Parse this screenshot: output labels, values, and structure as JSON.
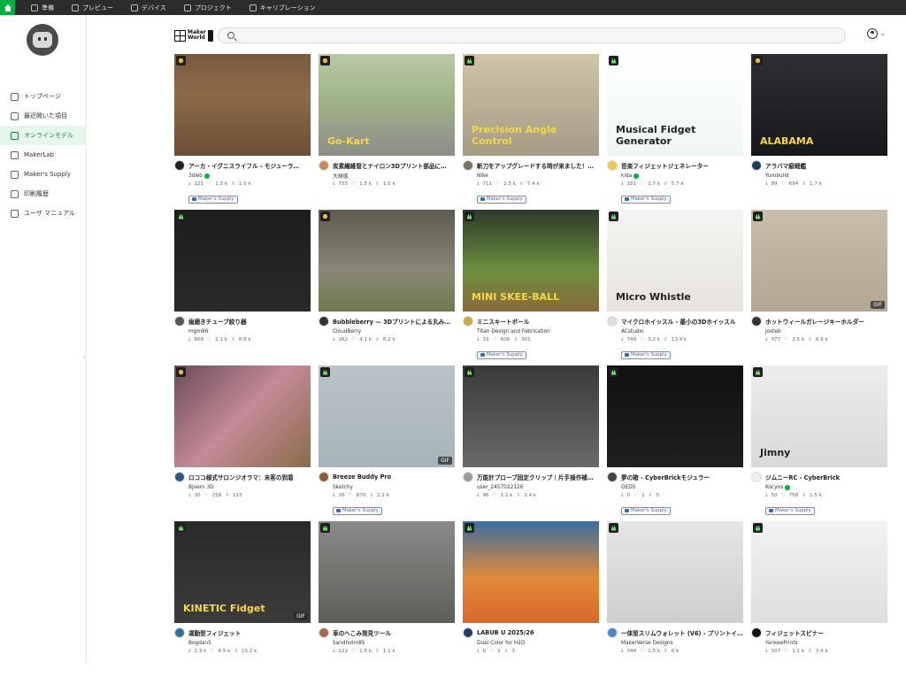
{
  "topbar": {
    "tabs": [
      {
        "label": "準備",
        "icon": "home-icon"
      },
      {
        "label": "プレビュー",
        "icon": "layers-icon"
      },
      {
        "label": "デバイス",
        "icon": "device-icon"
      },
      {
        "label": "プロジェクト",
        "icon": "project-icon"
      },
      {
        "label": "キャリブレーション",
        "icon": "calibration-icon"
      }
    ]
  },
  "sidebar": {
    "items": [
      {
        "label": "トップページ",
        "icon": "home-icon"
      },
      {
        "label": "最近開いた項目",
        "icon": "clock-icon"
      },
      {
        "label": "オンラインモデル",
        "icon": "grid-icon",
        "active": true
      },
      {
        "label": "MakerLab",
        "icon": "lab-icon"
      },
      {
        "label": "Maker's Supply",
        "icon": "supply-icon"
      },
      {
        "label": "印刷履歴",
        "icon": "history-icon"
      },
      {
        "label": "ユーザ マニュアル",
        "icon": "manual-icon"
      }
    ]
  },
  "header": {
    "logo_text_1": "Maker",
    "logo_text_2": "World",
    "search_placeholder": ""
  },
  "supply_label": "Maker's Supply",
  "colors": {
    "accent": "#00ae42",
    "supply": "#3d66b8",
    "topbar": "#2c2c2c"
  },
  "cards": [
    {
      "title": "アーカ・イグニスライフル - モジューラ…",
      "author": "3dwb",
      "verified": true,
      "stats": [
        "121",
        "1.3 k",
        "1.5 k"
      ],
      "supply": true,
      "badge": "gold",
      "gif": false,
      "thumb_text": "",
      "bg": "linear-gradient(180deg,#7a5a3e 0%,#8d6a48 40%,#6b4f35 100%)",
      "avatar": "#222"
    },
    {
      "title": "炭素繊維管とナイロン3Dプリント部品に…",
      "author": "大胡徳",
      "verified": false,
      "stats": [
        "755",
        "1.5 k",
        "1.5 k"
      ],
      "supply": false,
      "badge": "gold",
      "gif": false,
      "thumb_text": "Go-Kart",
      "bg": "linear-gradient(180deg,#b7c9a8 0%,#9fb387 45%,#8d8d88 100%)",
      "avatar": "#c98d5a"
    },
    {
      "title": "斬刀をアップグレードする時が来ました！…",
      "author": "Nike",
      "verified": false,
      "stats": [
        "711",
        "2.5 k",
        "7.4 k"
      ],
      "supply": true,
      "badge": "green",
      "gif": false,
      "thumb_text": "Precision Angle Control",
      "bg": "linear-gradient(180deg,#cfc4a8 0%,#a59c84 100%)",
      "avatar": "#7a6f62"
    },
    {
      "title": "音楽フィジェットジェネレーター",
      "author": "kida",
      "verified": true,
      "stats": [
        "181",
        "1.7 k",
        "5.7 k"
      ],
      "supply": true,
      "badge": "green",
      "gif": false,
      "thumb_text": "Musical Fidget Generator",
      "bg": "linear-gradient(180deg,#ffffff 0%,#eef6f5 100%)",
      "avatar": "#f2c94c"
    },
    {
      "title": "アラバマ級戦艦",
      "author": "Yurobuild",
      "verified": false,
      "stats": [
        "89",
        "694",
        "1.7 k"
      ],
      "supply": false,
      "badge": "gold",
      "gif": false,
      "thumb_text": "ALABAMA",
      "bg": "linear-gradient(180deg,#2d2f33 0%,#16181b 100%)",
      "avatar": "#1c3e57"
    },
    {
      "title": "歯磨きチューブ絞り器",
      "author": "mgm86",
      "verified": false,
      "stats": [
        "668",
        "2.1 k",
        "8.8 k"
      ],
      "supply": false,
      "badge": "green",
      "gif": false,
      "thumb_text": "",
      "bg": "linear-gradient(180deg,#1d1d1d 0%,#2a2a2a 100%)",
      "avatar": "#555"
    },
    {
      "title": "Bubbleberry — 3Dプリントによる丸み…",
      "author": "CloudBerry",
      "verified": false,
      "stats": [
        "262",
        "4.1 k",
        "8.2 k"
      ],
      "supply": false,
      "badge": "gold",
      "gif": false,
      "thumb_text": "",
      "bg": "linear-gradient(180deg,#5e5a4f 0%,#8a8778 60%,#6f7a4c 100%)",
      "avatar": "#333"
    },
    {
      "title": "ミニスキートボール",
      "author": "Titan Design and Fabrication",
      "verified": false,
      "stats": [
        "19",
        "606",
        "301"
      ],
      "supply": true,
      "badge": "green",
      "gif": false,
      "thumb_text": "MINI SKEE-BALL",
      "bg": "linear-gradient(180deg,#2e3a2a 0%,#6d8f3e 60%,#8a6a3c 100%)",
      "avatar": "#c9a64b"
    },
    {
      "title": "マイクロホイッスル - 最小の3Dホイッスル",
      "author": "ACstudio",
      "verified": false,
      "stats": [
        "749",
        "3.2 k",
        "13.4 k"
      ],
      "supply": true,
      "badge": "green",
      "gif": false,
      "thumb_text": "Micro Whistle",
      "bg": "linear-gradient(180deg,#f5f5f3 0%,#e7e3de 100%)",
      "avatar": "#ddd"
    },
    {
      "title": "ホットウィールガレージキーホルダー",
      "author": "josteb",
      "verified": false,
      "stats": [
        "377",
        "2.5 k",
        "6.9 k"
      ],
      "supply": false,
      "badge": "green",
      "gif": true,
      "thumb_text": "",
      "bg": "linear-gradient(180deg,#c9beaa 0%,#b3a692 100%)",
      "avatar": "#333"
    },
    {
      "title": "ロココ様式サロンジオラマ：未客の到着",
      "author": "Bjoern 3D",
      "verified": false,
      "stats": [
        "30",
        "258",
        "115"
      ],
      "supply": false,
      "badge": "gold",
      "gif": false,
      "thumb_text": "",
      "bg": "linear-gradient(135deg,#6d4b5b 0%,#c48a97 50%,#8a6c47 100%)",
      "avatar": "#2e5a7a"
    },
    {
      "title": "Breeze Buddy Pro",
      "author": "Sketchy",
      "verified": false,
      "stats": [
        "26",
        "870",
        "2.2 k"
      ],
      "supply": true,
      "badge": "green",
      "gif": true,
      "thumb_text": "",
      "bg": "linear-gradient(180deg,#b9c3c8 0%,#a7b4bb 100%)",
      "avatar": "#8f5b3a"
    },
    {
      "title": "万能計プローブ固定クリップ｜片手操作補…",
      "author": "user_2457022126",
      "verified": false,
      "stats": [
        "96",
        "1.1 k",
        "2.4 k"
      ],
      "supply": false,
      "badge": "green",
      "gif": false,
      "thumb_text": "",
      "bg": "linear-gradient(180deg,#3a3a3a 0%,#6a6a6a 100%)",
      "avatar": "#999"
    },
    {
      "title": "夢の箱 - CyberBrickモジュラー",
      "author": "OEDS",
      "verified": false,
      "stats": [
        "0",
        "2",
        "0"
      ],
      "supply": true,
      "badge": "green",
      "gif": false,
      "thumb_text": "",
      "bg": "linear-gradient(180deg,#111 0%,#1f1f1f 100%)",
      "avatar": "#444"
    },
    {
      "title": "ジムニーRC - CyberBrick",
      "author": "Kocyns",
      "verified": true,
      "stats": [
        "50",
        "758",
        "1.5 k"
      ],
      "supply": true,
      "badge": "green",
      "gif": false,
      "thumb_text": "Jimny",
      "bg": "linear-gradient(180deg,#ececec 0%,#d9d9d9 100%)",
      "avatar": "#eee"
    },
    {
      "title": "運動型フィジェット",
      "author": "Bogdan5",
      "verified": false,
      "stats": [
        "2.3 k",
        "4.5 k",
        "15.2 k"
      ],
      "supply": false,
      "badge": "green",
      "gif": true,
      "thumb_text": "KINETIC Fidget",
      "bg": "linear-gradient(180deg,#2a2a2a 0%,#3b3b3b 100%)",
      "avatar": "#2f6f9a"
    },
    {
      "title": "車のへこみ発見ツール",
      "author": "Sandholm85",
      "verified": false,
      "stats": [
        "122",
        "1.5 k",
        "1.1 k"
      ],
      "supply": false,
      "badge": "green",
      "gif": false,
      "thumb_text": "",
      "bg": "linear-gradient(180deg,#8a8a88 0%,#5e5e5b 100%)",
      "avatar": "#a56b4a"
    },
    {
      "title": "LABUB U 2025/26",
      "author": "Dual Color for H2D",
      "verified": false,
      "stats": [
        "0",
        "1",
        "3"
      ],
      "supply": false,
      "badge": "green",
      "gif": false,
      "thumb_text": "",
      "bg": "linear-gradient(180deg,#3b6ea0 0%,#e08a3a 55%,#d9672b 100%)",
      "avatar": "#1d3d6b"
    },
    {
      "title": "一体型スリムウォレット (V6) - プリントイ…",
      "author": "MakerVerse Designs",
      "verified": false,
      "stats": [
        "344",
        "1.5 k",
        "6 k"
      ],
      "supply": false,
      "badge": "green",
      "gif": false,
      "thumb_text": "",
      "bg": "linear-gradient(180deg,#e5e5e5 0%,#cfcfcf 100%)",
      "avatar": "#4b88c9"
    },
    {
      "title": "フィジェットスピナー",
      "author": "YankeePrints",
      "verified": false,
      "stats": [
        "107",
        "1.1 k",
        "3.4 k"
      ],
      "supply": false,
      "badge": "green",
      "gif": false,
      "thumb_text": "",
      "bg": "linear-gradient(180deg,#f2f2f2 0%,#dedede 100%)",
      "avatar": "#111"
    }
  ]
}
